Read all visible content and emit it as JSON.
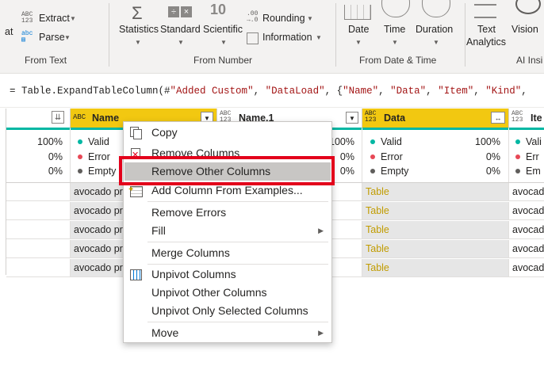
{
  "ribbon": {
    "from_text": {
      "partial": "at",
      "extract": "Extract",
      "parse": "Parse",
      "group_label": "From Text"
    },
    "from_number": {
      "statistics": "Statistics",
      "standard": "Standard",
      "scientific": "Scientific",
      "ten": "10",
      "rounding": "Rounding",
      "information": "Information",
      "group_label": "From Number",
      "dec_top": ".00",
      "dec_bottom": "→.0"
    },
    "from_date_time": {
      "date": "Date",
      "time": "Time",
      "duration": "Duration",
      "group_label": "From Date & Time"
    },
    "ai": {
      "text_analytics_1": "Text",
      "text_analytics_2": "Analytics",
      "vision": "Vision",
      "group_label": "AI Insi"
    }
  },
  "formula_bar": {
    "prefix": "= Table.ExpandTableColumn(#",
    "s1": "\"Added Custom\"",
    "sep1": ", ",
    "s2": "\"DataLoad\"",
    "sep2": ", {",
    "s3": "\"Name\"",
    "sep3": ", ",
    "s4": "\"Data\"",
    "sep4": ", ",
    "s5": "\"Item\"",
    "sep5": ", ",
    "s6": "\"Kind\"",
    "suffix": ","
  },
  "grid": {
    "columns": [
      {
        "name": "Name",
        "type_icon": "ABC"
      },
      {
        "name": "Name.1",
        "type_icon": "ABC 123"
      },
      {
        "name": "Data",
        "type_icon": "ABC 123"
      },
      {
        "name": "Ite",
        "type_icon": "ABC 123"
      }
    ],
    "type_abc": "ABC",
    "type_123": "123",
    "quality": {
      "left_valid": "100%",
      "left_error": "0%",
      "left_empty": "0%",
      "valid": "Valid",
      "error": "Error",
      "empty": "Empty",
      "name1_valid": "100%",
      "name1_error": "0%",
      "name1_empty": "0%",
      "data_valid": "100%",
      "data_error": "0%",
      "data_empty": "0%",
      "ite_valid": "Vali",
      "ite_error": "Err",
      "ite_empty": "Em"
    },
    "rows": [
      {
        "name": "avocado pr",
        "data": "Table",
        "item": "avocad"
      },
      {
        "name": "avocado pr",
        "data": "Table",
        "item": "avocad"
      },
      {
        "name": "avocado pr",
        "data": "Table",
        "item": "avocad"
      },
      {
        "name": "avocado pr",
        "data": "Table",
        "item": "avocad"
      },
      {
        "name": "avocado pr",
        "data": "Table",
        "item": "avocad"
      }
    ]
  },
  "context_menu": {
    "items": [
      {
        "label": "Copy"
      },
      {
        "label": "Remove Columns"
      },
      {
        "label": "Remove Other Columns"
      },
      {
        "label": "Add Column From Examples..."
      },
      {
        "label": "Remove Errors"
      },
      {
        "label": "Fill"
      },
      {
        "label": "Merge Columns"
      },
      {
        "label": "Unpivot Columns"
      },
      {
        "label": "Unpivot Other Columns"
      },
      {
        "label": "Unpivot Only Selected Columns"
      },
      {
        "label": "Move"
      }
    ],
    "highlighted_index": 2
  },
  "colors": {
    "valid": "#00b7a3",
    "error": "#e74856",
    "empty": "#605e5c",
    "selected_header": "#f2c811",
    "selected_column": "#e6e6e6",
    "table_link": "#c19c00",
    "annotation": "#e3001b"
  }
}
